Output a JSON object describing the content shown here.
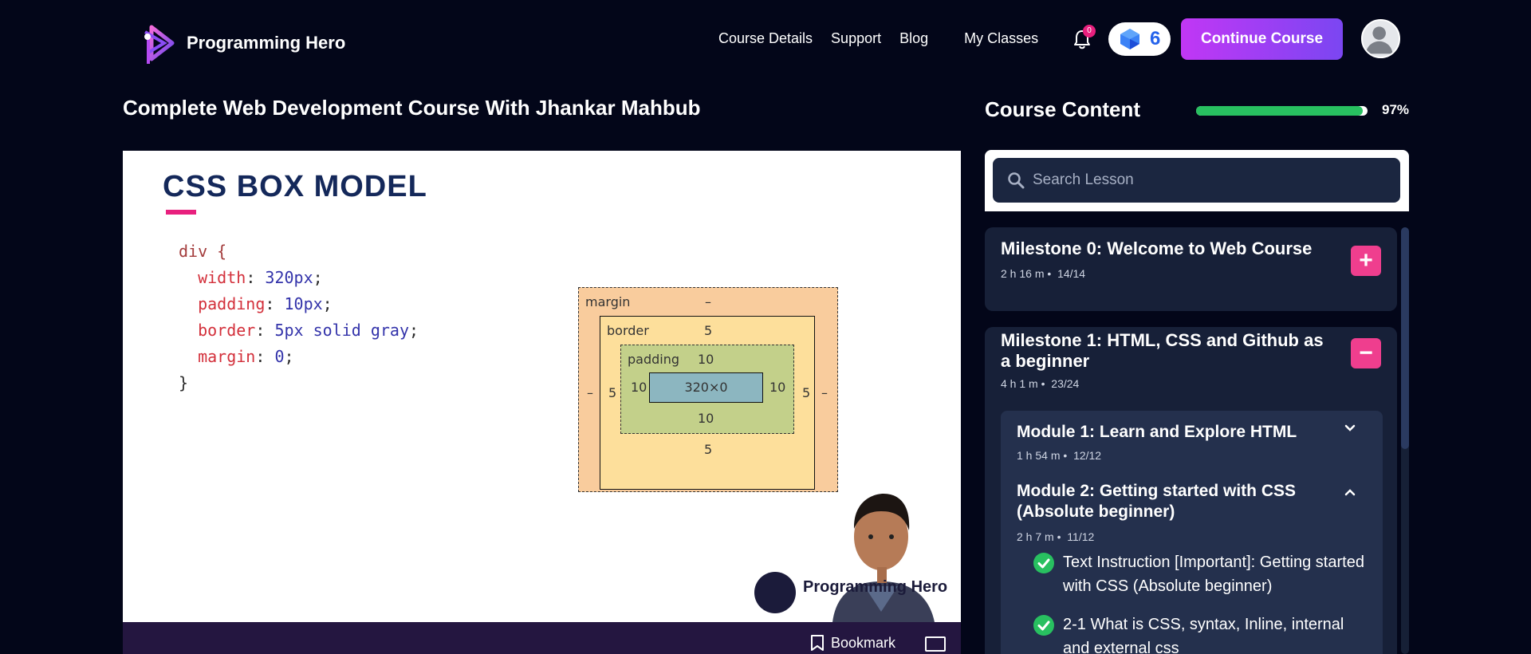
{
  "header": {
    "brand": "Programming Hero",
    "nav": [
      "Course Details",
      "Support",
      "Blog",
      "My Classes"
    ],
    "notifications_count": "0",
    "gems": "6",
    "continue_button": "Continue Course",
    "icons": {
      "logo": "programming-hero-logo",
      "bell": "bell-icon",
      "gem": "gem-icon",
      "avatar": "user-avatar"
    }
  },
  "course": {
    "title": "Complete Web Development Course With Jhankar Mahbub"
  },
  "video": {
    "slide_title": "CSS BOX MODEL",
    "code_lines": [
      {
        "sel": "div {"
      },
      {
        "prop": "width",
        "val": "320px"
      },
      {
        "prop": "padding",
        "val": "10px"
      },
      {
        "prop": "border",
        "val": "5px solid gray"
      },
      {
        "prop": "margin",
        "val": "0"
      },
      {
        "sel": "}"
      }
    ],
    "box_model": {
      "margin_label": "margin",
      "margin_value": "–",
      "border_label": "border",
      "border_value": "5",
      "padding_label": "padding",
      "padding_value": "10",
      "content": "320×0"
    },
    "presenter_chip": "Programming Hero",
    "bookmark": "Bookmark",
    "icons": {
      "bookmark": "bookmark-icon",
      "screen": "screen-icon"
    }
  },
  "content": {
    "title": "Course Content",
    "progress_percent": 97,
    "progress_label": "97%",
    "search_placeholder": "Search Lesson",
    "milestones": [
      {
        "title": "Milestone 0: Welcome to Web Course",
        "duration": "2 h 16 m",
        "count": "14/14",
        "expanded": false
      },
      {
        "title": "Milestone 1: HTML, CSS and Github as a beginner",
        "duration": "4 h 1 m",
        "count": "23/24",
        "expanded": true
      }
    ],
    "modules": [
      {
        "title": "Module 1: Learn and Explore HTML",
        "duration": "1 h 54 m",
        "count": "12/12"
      },
      {
        "title": "Module 2: Getting started with CSS (Absolute beginner)",
        "duration": "2 h 7 m",
        "count": "11/12"
      }
    ],
    "lessons": [
      {
        "title": "Text Instruction [Important]: Getting started with CSS (Absolute beginner)",
        "completed": true
      },
      {
        "title": "2-1 What is CSS, syntax, Inline, internal and external css",
        "completed": true
      }
    ]
  },
  "colors": {
    "accent": "#ef3e8e",
    "progress": "#28c060",
    "brand_gradient": "#c137f5"
  }
}
